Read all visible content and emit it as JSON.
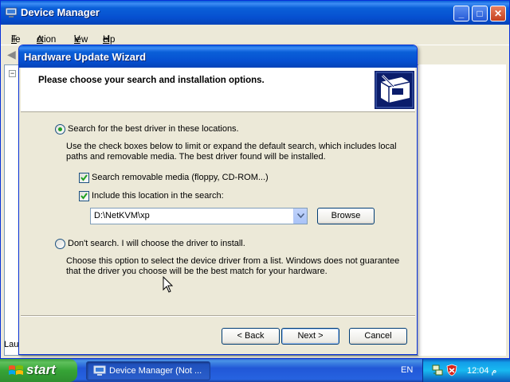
{
  "device_manager": {
    "title": "Device Manager",
    "menu": [
      "File",
      "Action",
      "View",
      "Help"
    ],
    "status_text": "Lau"
  },
  "wizard": {
    "title": "Hardware Update Wizard",
    "header": "Please choose your search and installation options.",
    "option_search": {
      "label": "Search for the best driver in these locations.",
      "selected": true,
      "description": "Use the check boxes below to limit or expand the default search, which includes local paths and removable media. The best driver found will be installed."
    },
    "checkbox_removable": {
      "label": "Search removable media (floppy, CD-ROM...)",
      "checked": true
    },
    "checkbox_location": {
      "label": "Include this location in the search:",
      "checked": true
    },
    "path_value": "D:\\NetKVM\\xp",
    "browse_label": "Browse",
    "option_dont_search": {
      "label": "Don't search. I will choose the driver to install.",
      "selected": false,
      "description": "Choose this option to select the device driver from a list.  Windows does not guarantee that the driver you choose will be the best match for your hardware."
    },
    "buttons": {
      "back": "< Back",
      "next": "Next >",
      "cancel": "Cancel"
    }
  },
  "taskbar": {
    "start_label": "start",
    "task_label": "Device Manager (Not ...",
    "language": "EN",
    "clock": "12:04 م"
  },
  "colors": {
    "title_bar": "#0a5fd8",
    "taskbar": "#2157d7",
    "start_button": "#36a436",
    "dialog_face": "#ece9d8"
  }
}
